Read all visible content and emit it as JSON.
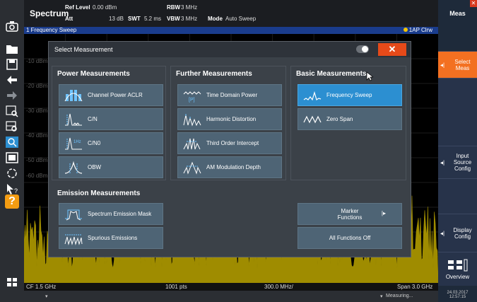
{
  "header": {
    "app_name": "Spectrum",
    "ref_level_label": "Ref Level",
    "ref_level_value": "0.00 dBm",
    "att_label": "Att",
    "att_value": "13 dB",
    "swt_label": "SWT",
    "swt_value": "5.2 ms",
    "rbw_label": "RBW",
    "rbw_value": "3 MHz",
    "vbw_label": "VBW",
    "vbw_value": "3 MHz",
    "mode_label": "Mode",
    "mode_value": "Auto Sweep"
  },
  "sweep_bar": {
    "title": "1 Frequency Sweep",
    "trace_tag": "1AP Clrw"
  },
  "plot": {
    "dbm_labels": [
      "-10 dBm",
      "-20 dBm",
      "-30 dBm",
      "-40 dBm",
      "-50 dBm",
      "-60 dBm"
    ]
  },
  "footer": {
    "cf": "CF 1.5 GHz",
    "pts": "1001 pts",
    "span_div": "300.0 MHz/",
    "span": "Span 3.0 GHz"
  },
  "status": {
    "measuring": "Measuring...",
    "date": "24.03.2017",
    "time": "12:57:15"
  },
  "right_panel": {
    "title": "Meas",
    "buttons": [
      "Select Meas",
      "Input Source Config",
      "Display Config",
      "Overview"
    ]
  },
  "dialog": {
    "title": "Select Measurement",
    "close_label": "✕",
    "power_head": "Power Measurements",
    "further_head": "Further Measurements",
    "basic_head": "Basic Measurements",
    "emission_head": "Emission Measurements",
    "power": [
      "Channel Power ACLR",
      "C/N",
      "C/N0",
      "OBW"
    ],
    "further": [
      "Time Domain Power",
      "Harmonic Distortion",
      "Third Order Intercept",
      "AM Modulation Depth"
    ],
    "basic": [
      "Frequency Sweep",
      "Zero Span"
    ],
    "emission": [
      "Spectrum Emission Mask",
      "Spurious Emissions"
    ],
    "marker_functions": "Marker Functions",
    "all_functions_off": "All Functions Off"
  },
  "colors": {
    "accent_orange": "#f37021",
    "selected_blue": "#2c8fd1",
    "trace_yellow": "#f5d800"
  }
}
